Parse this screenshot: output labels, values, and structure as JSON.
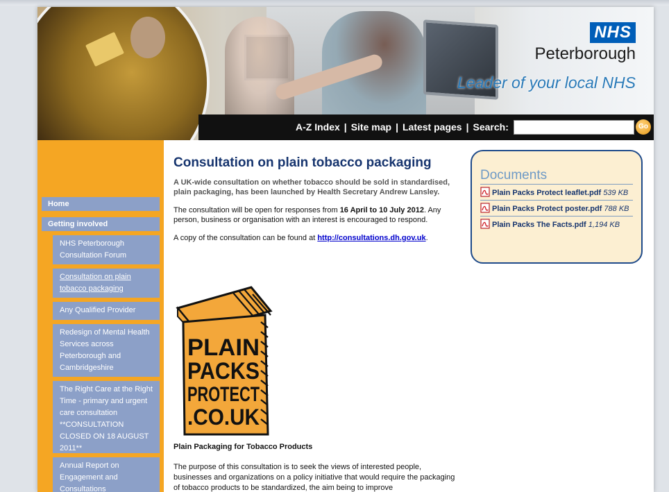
{
  "header": {
    "nhs_logo": "NHS",
    "org_name": "Peterborough",
    "tagline": "Leader of your local NHS"
  },
  "nav": {
    "az_index": "A-Z Index",
    "site_map": "Site map",
    "latest_pages": "Latest pages",
    "search_label": "Search:",
    "separator": "|",
    "search_value": "",
    "go_label": "Go"
  },
  "sidebar": {
    "home": "Home",
    "getting_involved": "Getting involved",
    "items": [
      {
        "label": "NHS Peterborough Consultation Forum"
      },
      {
        "label": "Consultation on plain tobacco packaging"
      },
      {
        "label": "Any Qualified Provider"
      },
      {
        "label": "Redesign of Mental Health Services across Peterborough and Cambridgeshire"
      },
      {
        "label": "The Right Care at the Right Time - primary and urgent care consultation **CONSULTATION CLOSED ON 18 AUGUST 2011**"
      },
      {
        "label": "Annual Report on Engagement and Consultations"
      }
    ]
  },
  "main": {
    "title": "Consultation on plain tobacco packaging",
    "lead": "A UK-wide consultation on whether tobacco should be sold in standardised, plain packaging, has been launched by Health Secretary Andrew Lansley.",
    "p1_a": "The consultation will be open for responses from ",
    "p1_dates": "16 April to 10 July 2012",
    "p1_b": ". Any person, business or organisation with an interest is encouraged to respond.",
    "p2_a": "A copy of the consultation can be found at ",
    "p2_link": "http://consultations.dh.gov.uk",
    "p2_b": ".",
    "poster_lines": [
      "PLAIN",
      "PACKS",
      "PROTECT",
      ".CO.UK"
    ],
    "subheading": "Plain Packaging for Tobacco Products",
    "body": "The purpose of this consultation is to seek the views of interested people, businesses and organizations on a policy initiative that would require the packaging of tobacco products to be standardized, the aim being to improve"
  },
  "documents": {
    "title": "Documents",
    "items": [
      {
        "name": "Plain Packs Protect leaflet.pdf",
        "size": "539 KB"
      },
      {
        "name": "Plain Packs Protect poster.pdf",
        "size": "788 KB"
      },
      {
        "name": "Plain Packs The Facts.pdf",
        "size": "1,194 KB"
      }
    ]
  }
}
